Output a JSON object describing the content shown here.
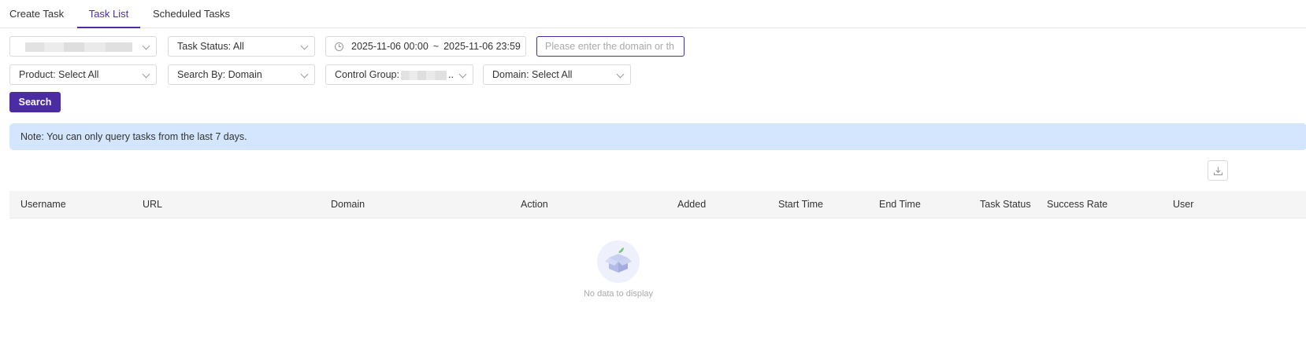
{
  "tabs": [
    {
      "label": "Create Task",
      "active": false
    },
    {
      "label": "Task List",
      "active": true
    },
    {
      "label": "Scheduled Tasks",
      "active": false
    }
  ],
  "filters": {
    "task_status": "Task Status: All",
    "date_range": {
      "start": "2025-11-06 00:00",
      "separator": "~",
      "end": "2025-11-06 23:59"
    },
    "search": {
      "value": "",
      "placeholder": "Please enter the domain or th"
    },
    "product": "Product: Select All",
    "search_by": "Search By: Domain",
    "control_group_label": "Control Group:",
    "control_group_suffix": "..",
    "domain": "Domain: Select All"
  },
  "search_button": "Search",
  "note": "Note: You can only query tasks from the last 7 days.",
  "table": {
    "columns": [
      "Username",
      "URL",
      "Domain",
      "Action",
      "Added",
      "Start Time",
      "End Time",
      "Task Status",
      "Success Rate",
      "User"
    ],
    "rows": []
  },
  "empty_state": {
    "text": "No data to display"
  },
  "colors": {
    "accent": "#4b2ca3",
    "note_bg": "#d3e6fd",
    "table_header_bg": "#f5f5f5"
  },
  "icons": {
    "date": "clock-icon",
    "export": "download-icon",
    "empty": "empty-box-icon",
    "dropdown": "chevron-down-icon"
  }
}
